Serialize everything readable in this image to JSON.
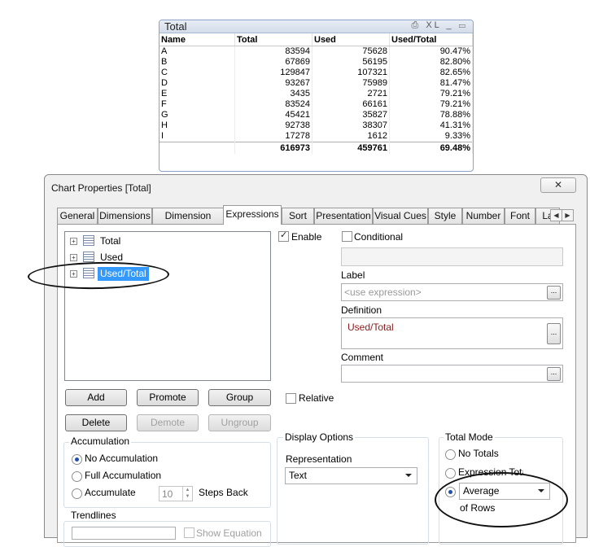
{
  "table": {
    "title": "Total",
    "icons": [
      "print-icon",
      "xl-icon",
      "minimize-icon",
      "maximize-icon"
    ],
    "icon_text": {
      "xl": "XL",
      "print": "⎙",
      "min": "_",
      "max": "▭"
    },
    "columns": [
      "Name",
      "Total",
      "Used",
      "Used/Total"
    ],
    "rows": [
      [
        "A",
        "83594",
        "75628",
        "90.47%"
      ],
      [
        "B",
        "67869",
        "56195",
        "82.80%"
      ],
      [
        "C",
        "129847",
        "107321",
        "82.65%"
      ],
      [
        "D",
        "93267",
        "75989",
        "81.47%"
      ],
      [
        "E",
        "3435",
        "2721",
        "79.21%"
      ],
      [
        "F",
        "83524",
        "66161",
        "79.21%"
      ],
      [
        "G",
        "45421",
        "35827",
        "78.88%"
      ],
      [
        "H",
        "92738",
        "38307",
        "41.31%"
      ],
      [
        "I",
        "17278",
        "1612",
        "9.33%"
      ]
    ],
    "totals": [
      "",
      "616973",
      "459761",
      "69.48%"
    ]
  },
  "dialog": {
    "title": "Chart Properties [Total]",
    "close_glyph": "✕",
    "tabs": [
      "General",
      "Dimensions",
      "Dimension Limits",
      "Expressions",
      "Sort",
      "Presentation",
      "Visual Cues",
      "Style",
      "Number",
      "Font",
      "La"
    ],
    "active_tab": "Expressions",
    "tab_scroll": {
      "left": "◀",
      "right": "▶"
    },
    "expressions": [
      "Total",
      "Used",
      "Used/Total"
    ],
    "selected_expression": "Used/Total",
    "expand_glyph": "+",
    "buttons": {
      "add": "Add",
      "promote": "Promote",
      "group": "Group",
      "delete": "Delete",
      "demote": "Demote",
      "ungroup": "Ungroup"
    },
    "enable_label": "Enable",
    "conditional_label": "Conditional",
    "label_caption": "Label",
    "label_placeholder": "<use expression>",
    "definition_caption": "Definition",
    "definition_value": "Used/Total",
    "comment_caption": "Comment",
    "ellipsis": "...",
    "relative_label": "Relative",
    "accumulation": {
      "title": "Accumulation",
      "options": [
        "No Accumulation",
        "Full Accumulation",
        "Accumulate"
      ],
      "selected": "No Accumulation",
      "steps_value": "10",
      "steps_label": "Steps Back"
    },
    "trendlines_title": "Trendlines",
    "show_equation_label": "Show Equation",
    "display_options": {
      "title": "Display Options",
      "representation_caption": "Representation",
      "representation_value": "Text"
    },
    "total_mode": {
      "title": "Total Mode",
      "options": [
        "No Totals",
        "Expression Total"
      ],
      "selected_function": "Average",
      "of_rows": "of Rows"
    }
  }
}
